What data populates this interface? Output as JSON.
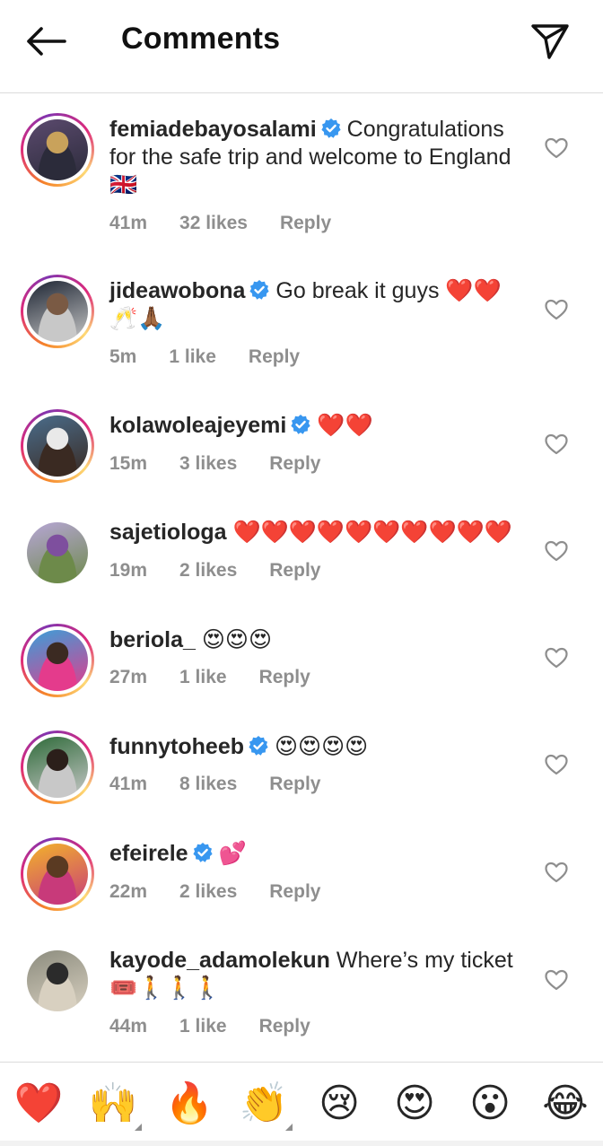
{
  "header": {
    "title": "Comments",
    "back_icon": "arrow-left-icon",
    "share_icon": "paper-plane-icon"
  },
  "comments": [
    {
      "username": "femiadebayosalami",
      "verified": true,
      "text": "Congratulations for the safe trip and welcome to England 🇬🇧",
      "time": "41m",
      "likes": "32 likes",
      "reply": "Reply",
      "avatar_ring": true,
      "avatar_colors": [
        "#5b4a6e",
        "#c9a25b",
        "#2b2b3a"
      ]
    },
    {
      "username": "jideawobona",
      "verified": true,
      "text": "Go break it guys ❤️❤️🥂🙏🏾",
      "time": "5m",
      "likes": "1 like",
      "reply": "Reply",
      "avatar_ring": true,
      "avatar_colors": [
        "#1d2533",
        "#7a5a44",
        "#c8c8c8"
      ]
    },
    {
      "username": "kolawoleajeyemi",
      "verified": true,
      "text": "❤️❤️",
      "time": "15m",
      "likes": "3 likes",
      "reply": "Reply",
      "avatar_ring": true,
      "avatar_colors": [
        "#4a6d8c",
        "#e9e9e9",
        "#3a2a22"
      ]
    },
    {
      "username": "sajetiologa",
      "verified": false,
      "text": "❤️❤️❤️❤️❤️❤️❤️❤️❤️❤️",
      "time": "19m",
      "likes": "2 likes",
      "reply": "Reply",
      "avatar_ring": false,
      "avatar_colors": [
        "#b7a6d6",
        "#7e4f9e",
        "#6d8a4a"
      ]
    },
    {
      "username": "beriola_",
      "verified": false,
      "text": "😍😍😍",
      "time": "27m",
      "likes": "1 like",
      "reply": "Reply",
      "avatar_ring": true,
      "avatar_colors": [
        "#3a9fd8",
        "#3b2a22",
        "#e43b8c"
      ]
    },
    {
      "username": "funnytoheeb",
      "verified": true,
      "text": "😍😍😍😍",
      "time": "41m",
      "likes": "8 likes",
      "reply": "Reply",
      "avatar_ring": true,
      "avatar_colors": [
        "#2f6b3a",
        "#2b1f1a",
        "#c8c8c8"
      ]
    },
    {
      "username": "efeirele",
      "verified": true,
      "text": "💕",
      "time": "22m",
      "likes": "2 likes",
      "reply": "Reply",
      "avatar_ring": true,
      "avatar_colors": [
        "#f2b32a",
        "#5a3a22",
        "#c83a7a"
      ]
    },
    {
      "username": "kayode_adamolekun",
      "verified": false,
      "text": "Where’s my ticket 🎟️🚶🚶🚶",
      "time": "44m",
      "likes": "1 like",
      "reply": "Reply",
      "avatar_ring": false,
      "avatar_colors": [
        "#8c8c7e",
        "#2b2b2b",
        "#d8d0c0"
      ]
    }
  ],
  "reaction_tray": [
    {
      "emoji": "❤️",
      "icon": "red-heart-emoji",
      "has_variants": false
    },
    {
      "emoji": "🙌",
      "icon": "raising-hands-emoji",
      "has_variants": true
    },
    {
      "emoji": "🔥",
      "icon": "fire-emoji",
      "has_variants": false
    },
    {
      "emoji": "👏",
      "icon": "clapping-hands-emoji",
      "has_variants": true
    },
    {
      "emoji": "😢",
      "icon": "crying-face-emoji",
      "has_variants": false
    },
    {
      "emoji": "😍",
      "icon": "heart-eyes-emoji",
      "has_variants": false
    },
    {
      "emoji": "😮",
      "icon": "surprised-face-emoji",
      "has_variants": false
    },
    {
      "emoji": "😂",
      "icon": "tears-of-joy-emoji",
      "has_variants": false
    }
  ],
  "colors": {
    "verified_blue": "#3897f0",
    "meta_gray": "#8e8e8e",
    "divider": "#dbdbdb"
  }
}
